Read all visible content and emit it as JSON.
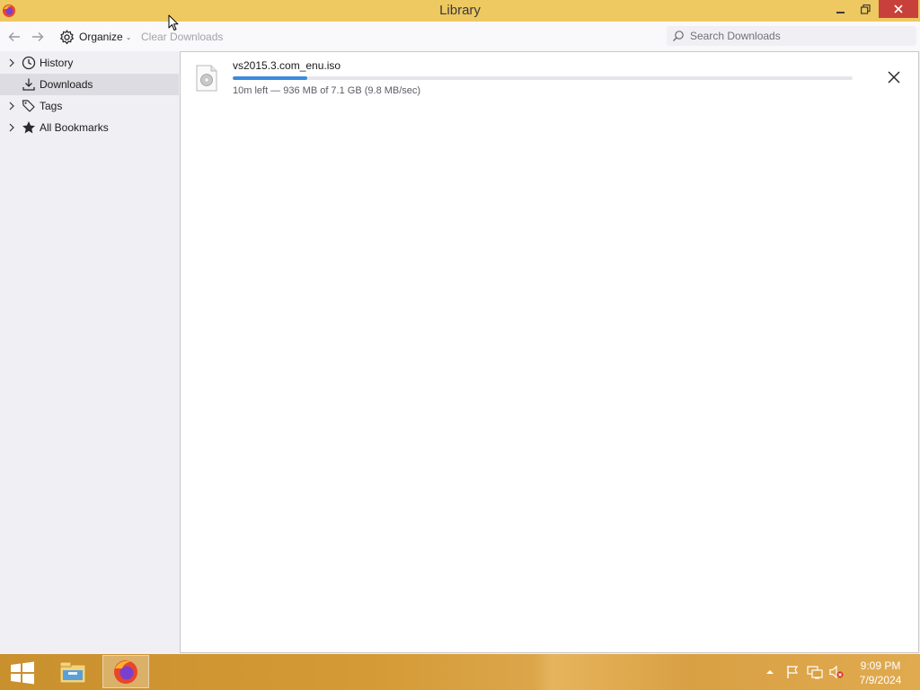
{
  "window": {
    "title": "Library",
    "icon": "firefox-icon",
    "controls": [
      "minimize-icon",
      "restore-icon",
      "close-icon"
    ]
  },
  "toolbar": {
    "organize_label": "Organize",
    "clear_label": "Clear Downloads",
    "search_placeholder": "Search Downloads",
    "search_value": ""
  },
  "sidebar": {
    "items": [
      {
        "label": "History",
        "icon": "clock-icon",
        "expandable": true,
        "selected": false
      },
      {
        "label": "Downloads",
        "icon": "download-icon",
        "expandable": false,
        "selected": true
      },
      {
        "label": "Tags",
        "icon": "tags-icon",
        "expandable": true,
        "selected": false
      },
      {
        "label": "All Bookmarks",
        "icon": "star-icon",
        "expandable": true,
        "selected": false
      }
    ]
  },
  "downloads": [
    {
      "filename": "vs2015.3.com_enu.iso",
      "status": "10m left — 936 MB of 7.1 GB (9.8 MB/sec)",
      "progress": 0.12
    }
  ],
  "taskbar": {
    "time": "9:09 PM",
    "date": "7/9/2024"
  },
  "colors": {
    "titlebar": "#eec860",
    "close_button": "#c7413a",
    "progress": "#3b8ae0",
    "selected_item": "#dcdce2"
  }
}
